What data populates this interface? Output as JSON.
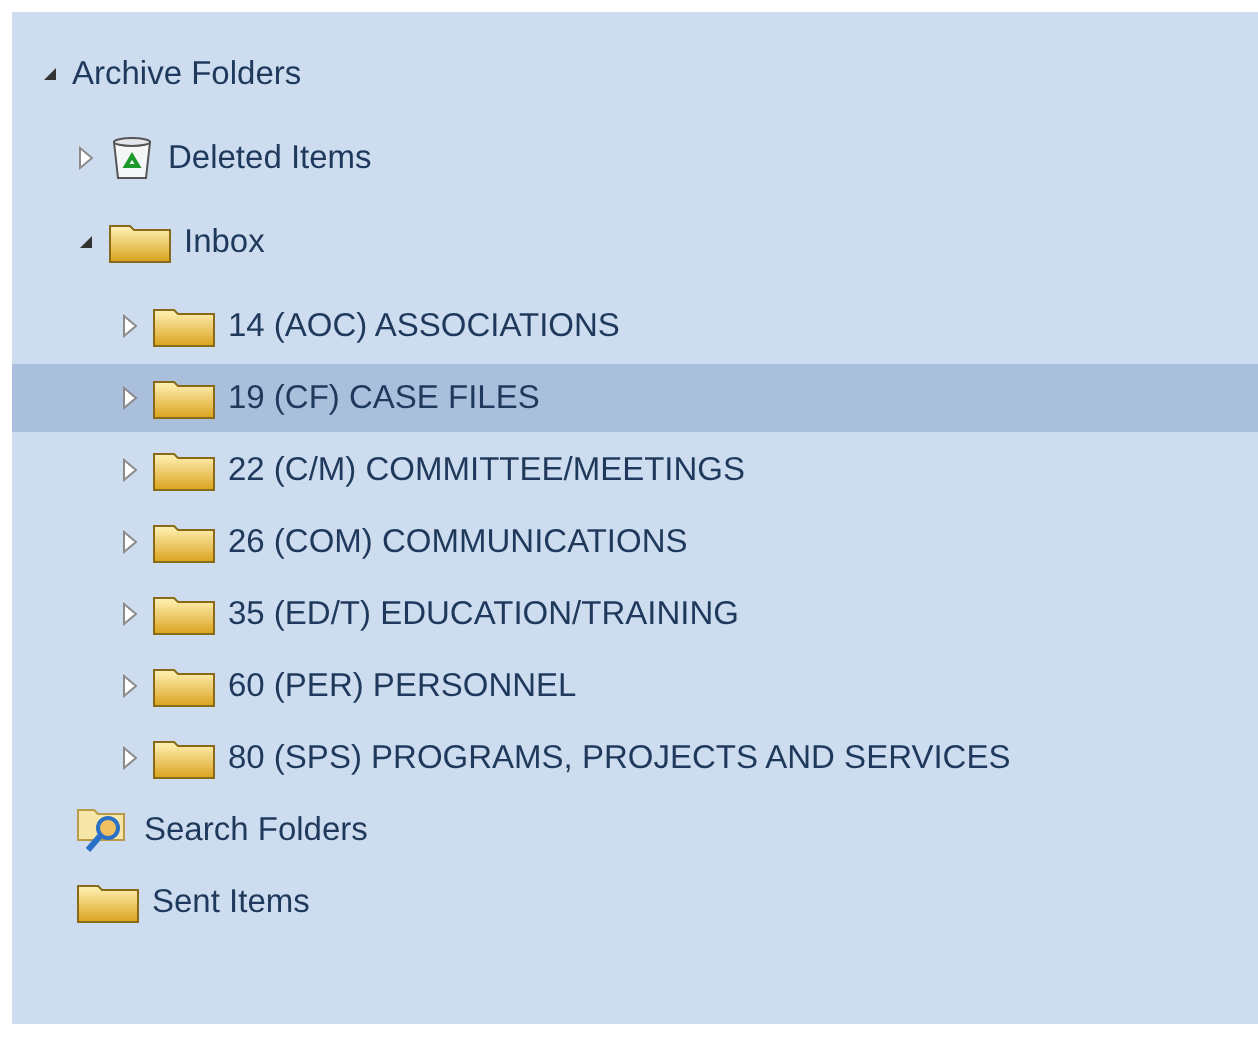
{
  "tree": [
    {
      "label": "Archive Folders",
      "expanded": true,
      "selected": false,
      "children": [
        {
          "label": "Deleted Items",
          "kind": "trash",
          "expanded": false,
          "selected": false
        },
        {
          "label": "Inbox",
          "kind": "folder",
          "expanded": true,
          "selected": false,
          "children": [
            {
              "label": "14 (AOC) ASSOCIATIONS",
              "kind": "folder",
              "expanded": false,
              "selected": false
            },
            {
              "label": "19 (CF) CASE FILES",
              "kind": "folder",
              "expanded": false,
              "selected": true
            },
            {
              "label": "22 (C/M) COMMITTEE/MEETINGS",
              "kind": "folder",
              "expanded": false,
              "selected": false
            },
            {
              "label": "26 (COM) COMMUNICATIONS",
              "kind": "folder",
              "expanded": false,
              "selected": false
            },
            {
              "label": "35 (ED/T) EDUCATION/TRAINING",
              "kind": "folder",
              "expanded": false,
              "selected": false
            },
            {
              "label": "60 (PER) PERSONNEL",
              "kind": "folder",
              "expanded": false,
              "selected": false
            },
            {
              "label": "80 (SPS) PROGRAMS, PROJECTS AND SERVICES",
              "kind": "folder",
              "expanded": false,
              "selected": false
            }
          ]
        },
        {
          "label": "Search Folders",
          "kind": "search",
          "selected": false
        },
        {
          "label": "Sent Items",
          "kind": "folder",
          "selected": false
        }
      ]
    }
  ]
}
